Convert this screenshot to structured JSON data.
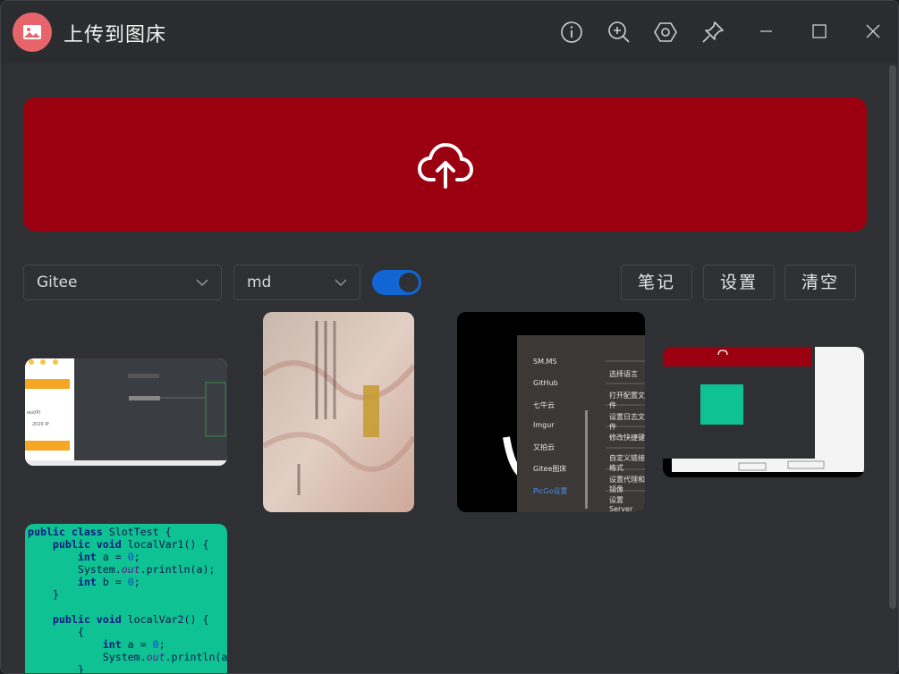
{
  "app": {
    "title": "上传到图床"
  },
  "toolbar": {
    "icons": [
      "info-icon",
      "zoom-in-icon",
      "settings-hex-icon",
      "pin-icon"
    ],
    "window_controls": [
      "minimize-icon",
      "maximize-icon",
      "close-icon"
    ]
  },
  "upload": {
    "icon": "cloud-upload-icon",
    "color": "#9b0010"
  },
  "controls": {
    "picbed_select": "Gitee",
    "format_select": "md",
    "toggle_on": true,
    "notes_label": "笔记",
    "settings_label": "设置",
    "clear_label": "清空"
  },
  "thumb3_menu": {
    "left": [
      "SM.MS",
      "GitHub",
      "七牛云",
      "Imgur",
      "又拍云",
      "Gitee图床",
      "PicGo设置"
    ],
    "right": [
      "选择语言",
      "打开配置文件",
      "设置日志文件",
      "修改快捷键",
      "自定义链接格式",
      "设置代理和镜像",
      "设置Server"
    ]
  },
  "thumb5_code": {
    "line1_a": "public class",
    "line1_b": " SlotTest {",
    "line2_a": "    public void",
    "line2_b": " localVar1() {",
    "line3_a": "        int",
    "line3_b": " a = ",
    "line3_c": "0",
    "line3_d": ";",
    "line4_a": "        System.",
    "line4_b": "out",
    "line4_c": ".println(a);",
    "line5_a": "        int",
    "line5_b": " b = ",
    "line5_c": "0",
    "line5_d": ";",
    "line6": "    }",
    "line8_a": "    public void",
    "line8_b": " localVar2() {",
    "line9": "        {",
    "line10_a": "            int",
    "line10_b": " a = ",
    "line10_c": "0",
    "line10_d": ";",
    "line11_a": "            System.",
    "line11_b": "out",
    "line11_c": ".println(a);",
    "line12": "        }"
  },
  "colors": {
    "accent": "#1166d4",
    "logo": "#e8646b",
    "code_bg": "#0fc293"
  }
}
